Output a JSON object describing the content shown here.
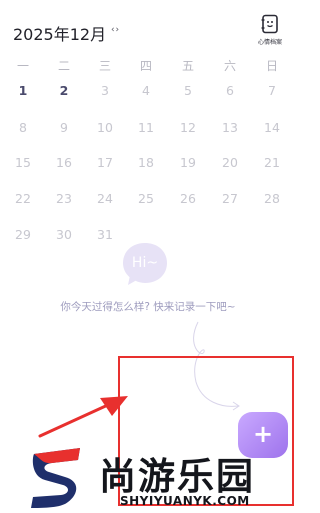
{
  "header": {
    "month_title": "2025年12月",
    "nav_arrows": "‹ ›",
    "mood_archive_label": "心情档案",
    "mood_archive_icon": "notebook-face-icon"
  },
  "calendar": {
    "weekdays": [
      "一",
      "二",
      "三",
      "四",
      "五",
      "六",
      "日"
    ],
    "weeks": [
      [
        "1",
        "2",
        "3",
        "4",
        "5",
        "6",
        "7"
      ],
      [
        "8",
        "9",
        "10",
        "11",
        "12",
        "13",
        "14"
      ],
      [
        "15",
        "16",
        "17",
        "18",
        "19",
        "20",
        "21"
      ],
      [
        "22",
        "23",
        "24",
        "25",
        "26",
        "27",
        "28"
      ],
      [
        "29",
        "30",
        "31"
      ]
    ],
    "active_days": [
      "1",
      "2"
    ]
  },
  "empty_state": {
    "bubble_text": "Hi~",
    "prompt": "你今天过得怎么样? 快来记录一下吧~"
  },
  "fab": {
    "icon": "plus-icon",
    "label": "+"
  },
  "watermark": {
    "logo_letter": "S",
    "name": "尚游乐园",
    "url": "SHYIYUANYK.COM"
  },
  "colors": {
    "accent": "#9e73ec",
    "highlight": "#e8302e",
    "active_day": "#4a4a6c",
    "inactive_day": "#c7c7cf"
  }
}
